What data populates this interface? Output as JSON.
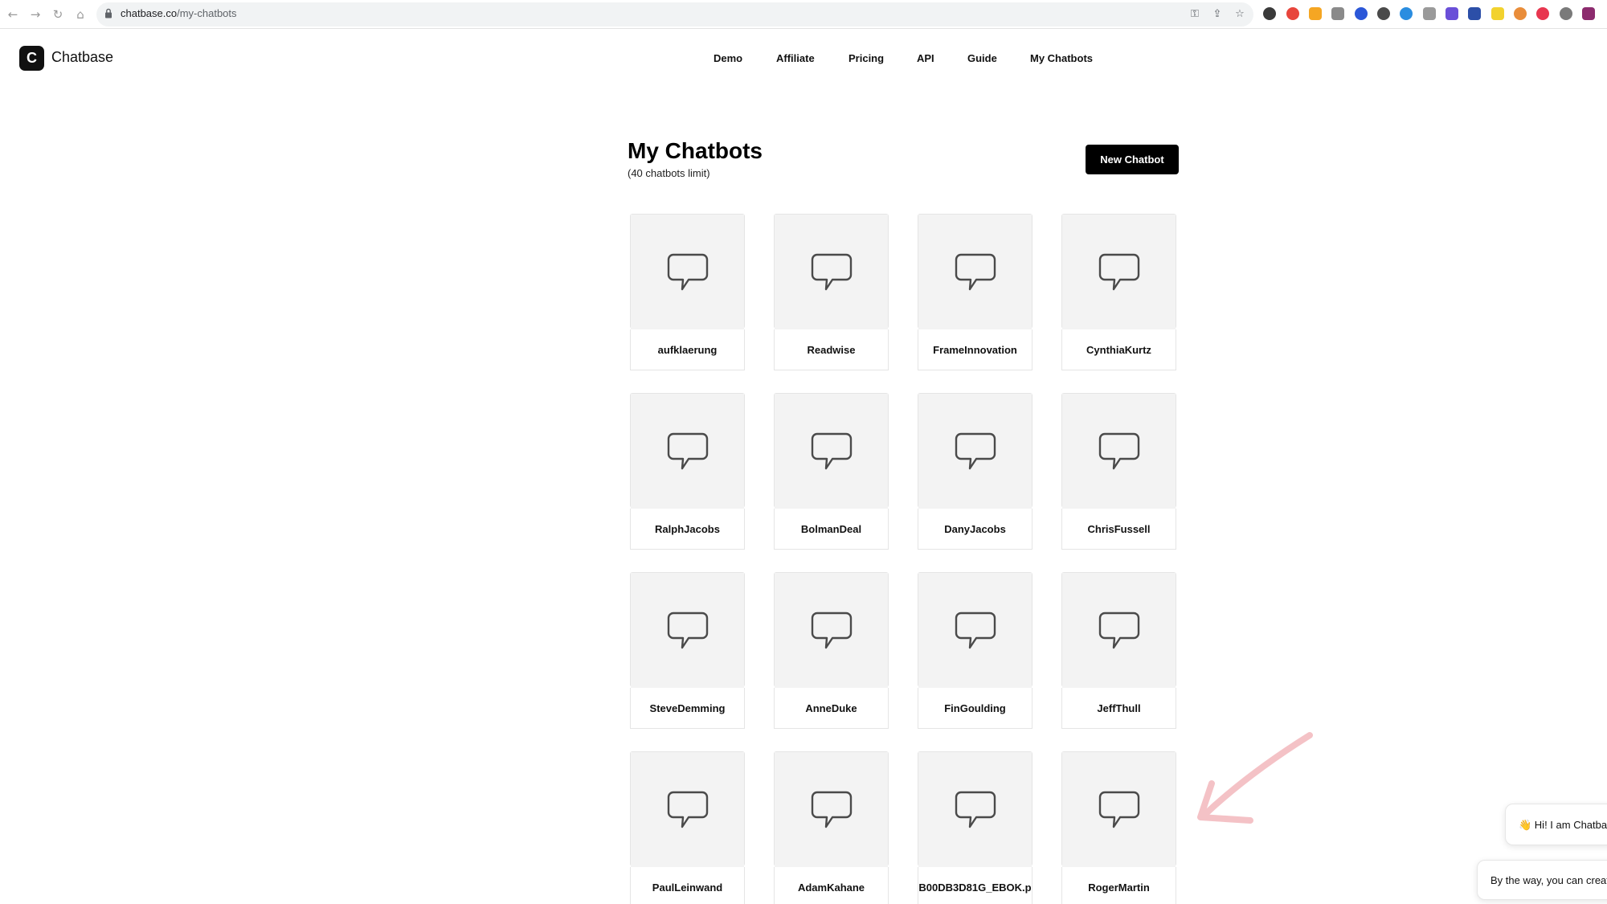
{
  "browser": {
    "url_domain": "chatbase.co",
    "url_path": "/my-chatbots"
  },
  "header": {
    "logo_letter": "C",
    "brand": "Chatbase",
    "nav": [
      "Demo",
      "Affiliate",
      "Pricing",
      "API",
      "Guide",
      "My Chatbots"
    ]
  },
  "page": {
    "title": "My Chatbots",
    "subtitle": "(40 chatbots limit)",
    "new_button": "New Chatbot"
  },
  "chatbots": [
    "aufklaerung",
    "Readwise",
    "FrameInnovation",
    "CynthiaKurtz",
    "RalphJacobs",
    "BolmanDeal",
    "DanyJacobs",
    "ChrisFussell",
    "SteveDemming",
    "AnneDuke",
    "FinGoulding",
    "JeffThull",
    "PaulLeinwand",
    "AdamKahane",
    "B00DB3D81G_EBOK.p",
    "RogerMartin"
  ],
  "chat_widget": {
    "greeting": "👋 Hi! I am Chatbas",
    "message": "By the way, you can create"
  },
  "colors": {
    "accent": "#000000",
    "card_thumb": "#f3f3f3",
    "annotation_arrow": "#f4c2c6"
  }
}
